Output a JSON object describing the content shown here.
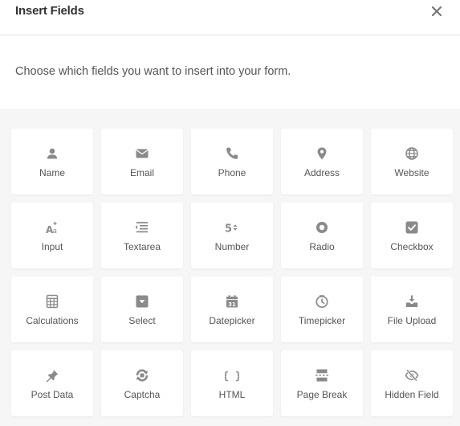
{
  "modal": {
    "title": "Insert Fields",
    "close_icon": "close-icon",
    "description": "Choose which fields you want to insert into your form."
  },
  "colors": {
    "icon": "#8a8a8a",
    "label": "#555555",
    "title": "#333333",
    "panel_bg": "#f6f6f6",
    "tile_bg": "#ffffff"
  },
  "fields": [
    {
      "label": "Name",
      "icon": "user-icon"
    },
    {
      "label": "Email",
      "icon": "envelope-icon"
    },
    {
      "label": "Phone",
      "icon": "phone-icon"
    },
    {
      "label": "Address",
      "icon": "map-pin-icon"
    },
    {
      "label": "Website",
      "icon": "globe-icon"
    },
    {
      "label": "Input",
      "icon": "text-input-icon"
    },
    {
      "label": "Textarea",
      "icon": "textarea-icon"
    },
    {
      "label": "Number",
      "icon": "number-icon"
    },
    {
      "label": "Radio",
      "icon": "radio-icon"
    },
    {
      "label": "Checkbox",
      "icon": "checkbox-icon"
    },
    {
      "label": "Calculations",
      "icon": "calculator-icon"
    },
    {
      "label": "Select",
      "icon": "select-icon"
    },
    {
      "label": "Datepicker",
      "icon": "calendar-icon"
    },
    {
      "label": "Timepicker",
      "icon": "clock-icon"
    },
    {
      "label": "File Upload",
      "icon": "upload-icon"
    },
    {
      "label": "Post Data",
      "icon": "pin-icon"
    },
    {
      "label": "Captcha",
      "icon": "captcha-icon"
    },
    {
      "label": "HTML",
      "icon": "code-icon"
    },
    {
      "label": "Page Break",
      "icon": "page-break-icon"
    },
    {
      "label": "Hidden Field",
      "icon": "eye-slash-icon"
    }
  ]
}
